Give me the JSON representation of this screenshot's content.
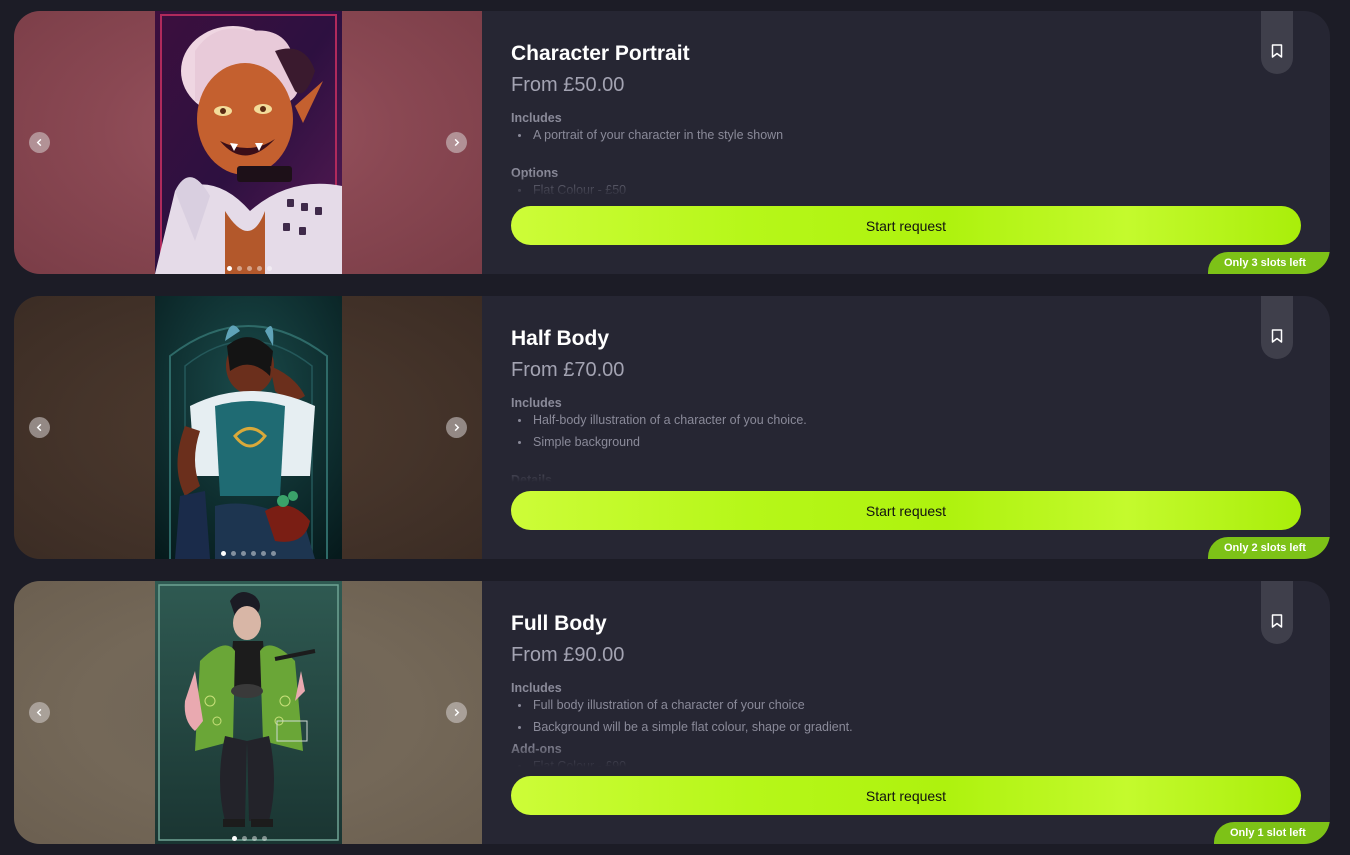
{
  "colors": {
    "page_bg": "#1c1c26",
    "card_bg": "#262633",
    "accent": "#b6f719",
    "slots_badge": "#7dc217",
    "muted_text": "#8a8a99"
  },
  "icons": {
    "prev": "chevron-left-icon",
    "next": "chevron-right-icon",
    "save": "bookmark-icon"
  },
  "cards": [
    {
      "title": "Character Portrait",
      "price": "From £50.00",
      "includes_title": "Includes",
      "includes": [
        "A portrait of your character in the style shown"
      ],
      "section2_title": "Options",
      "section2_items": [
        "Flat Colour - £50"
      ],
      "cta_label": "Start request",
      "slots_label": "Only 3 slots left",
      "image_count": 5,
      "active_image": 1
    },
    {
      "title": "Half Body",
      "price": "From £70.00",
      "includes_title": "Includes",
      "includes": [
        "Half-body illustration of a character of you choice.",
        "Simple background"
      ],
      "section2_title": "Details",
      "section2_items": [],
      "cta_label": "Start request",
      "slots_label": "Only 2 slots left",
      "image_count": 6,
      "active_image": 1
    },
    {
      "title": "Full Body",
      "price": "From £90.00",
      "includes_title": "Includes",
      "includes": [
        "Full body illustration of a character of your choice",
        "Background will be a simple flat colour, shape or gradient."
      ],
      "section2_title": "Add-ons",
      "section2_items": [
        "Flat Colour - £90"
      ],
      "cta_label": "Start request",
      "slots_label": "Only 1 slot left",
      "image_count": 4,
      "active_image": 1
    }
  ]
}
